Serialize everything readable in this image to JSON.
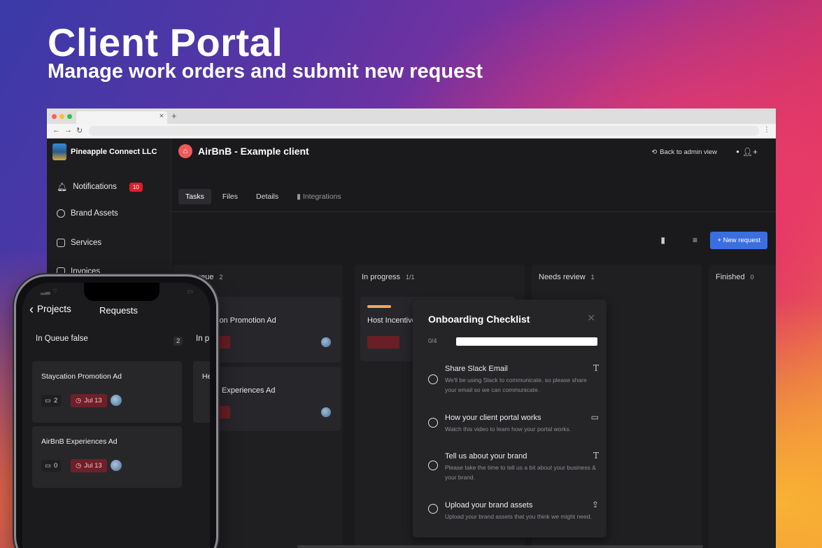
{
  "hero": {
    "title": "Client Portal",
    "subtitle": "Manage work orders and submit new request"
  },
  "sidebar": {
    "org_name": "Pineapple Connect LLC",
    "items": [
      {
        "label": "Notifications",
        "icon": "bell-icon",
        "badge": "10"
      },
      {
        "label": "Brand Assets",
        "icon": "shapes-icon"
      },
      {
        "label": "Services",
        "icon": "boxes-icon"
      },
      {
        "label": "Invoices",
        "icon": "invoice-icon"
      }
    ]
  },
  "header": {
    "client_name": "AirBnB - Example client",
    "back_to_admin": "Back to admin view"
  },
  "tabs": [
    "Tasks",
    "Files",
    "Details",
    "Integrations"
  ],
  "toolbar": {
    "new_request": "New request"
  },
  "board": {
    "columns": [
      {
        "title": "ueue",
        "count": "2",
        "cards": [
          "ion Promotion Ad",
          "Experiences Ad"
        ]
      },
      {
        "title": "In progress",
        "count": "1/1",
        "cards": [
          "Host Incentive Ad"
        ]
      },
      {
        "title": "Needs review",
        "count": "1",
        "cards": []
      },
      {
        "title": "Finished",
        "count": "0",
        "cards": []
      }
    ]
  },
  "onboarding": {
    "title": "Onboarding Checklist",
    "progress_label": "0/4",
    "progress": 0,
    "items": [
      {
        "name": "Share Slack Email",
        "desc": "We'll be using Slack to communicate, so please share your email so we can communicate.",
        "type_icon": "text-icon"
      },
      {
        "name": "How your client portal works",
        "desc": "Watch this video to learn how your portal works.",
        "type_icon": "video-icon"
      },
      {
        "name": "Tell us about your brand",
        "desc": "Please take the time to tell us a bit about your business & your brand.",
        "type_icon": "text-icon"
      },
      {
        "name": "Upload your brand assets",
        "desc": "Upload your brand assets that you think we might need.",
        "type_icon": "upload-icon"
      }
    ]
  },
  "phone": {
    "back_label": "Projects",
    "title": "Requests",
    "column_title": "In Queue false",
    "column_count": "2",
    "next_column_peek": "In p",
    "cards": [
      {
        "title": "Staycation Promotion Ad",
        "comments": "2",
        "date": "Jul 13"
      },
      {
        "title": "AirBnB Experiences Ad",
        "comments": "0",
        "date": "Jul 13"
      }
    ],
    "peek_card": "He"
  }
}
